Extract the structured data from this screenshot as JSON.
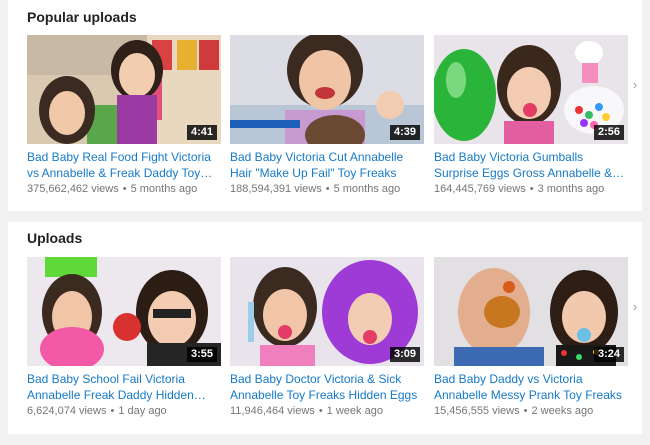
{
  "sections": [
    {
      "title": "Popular uploads",
      "videos": [
        {
          "title": "Bad Baby Real Food Fight Victoria vs Annabelle & Freak Daddy Toy Freaks",
          "duration": "4:41",
          "views": "375,662,462 views",
          "age": "5 months ago"
        },
        {
          "title": "Bad Baby Victoria Cut Annabelle Hair \"Make Up Fail\" Toy Freaks",
          "duration": "4:39",
          "views": "188,594,391 views",
          "age": "5 months ago"
        },
        {
          "title": "Bad Baby Victoria Gumballs Surprise Eggs Gross Annabelle & Daddy",
          "duration": "2:56",
          "views": "164,445,769 views",
          "age": "3 months ago"
        }
      ]
    },
    {
      "title": "Uploads",
      "videos": [
        {
          "title": "Bad Baby School Fail Victoria Annabelle Freak Daddy Hidden Eggs",
          "duration": "3:55",
          "views": "6,624,074 views",
          "age": "1 day ago"
        },
        {
          "title": "Bad Baby Doctor Victoria & Sick Annabelle Toy Freaks Hidden Eggs",
          "duration": "3:09",
          "views": "11,946,464 views",
          "age": "1 week ago"
        },
        {
          "title": "Bad Baby Daddy vs Victoria Annabelle Messy Prank Toy Freaks",
          "duration": "3:24",
          "views": "15,456,555 views",
          "age": "2 weeks ago"
        }
      ]
    }
  ],
  "arrow_icon": "chevron-right-icon",
  "colors": {
    "link": "#167ac6",
    "meta": "#767676",
    "background": "#f1f1f1"
  }
}
